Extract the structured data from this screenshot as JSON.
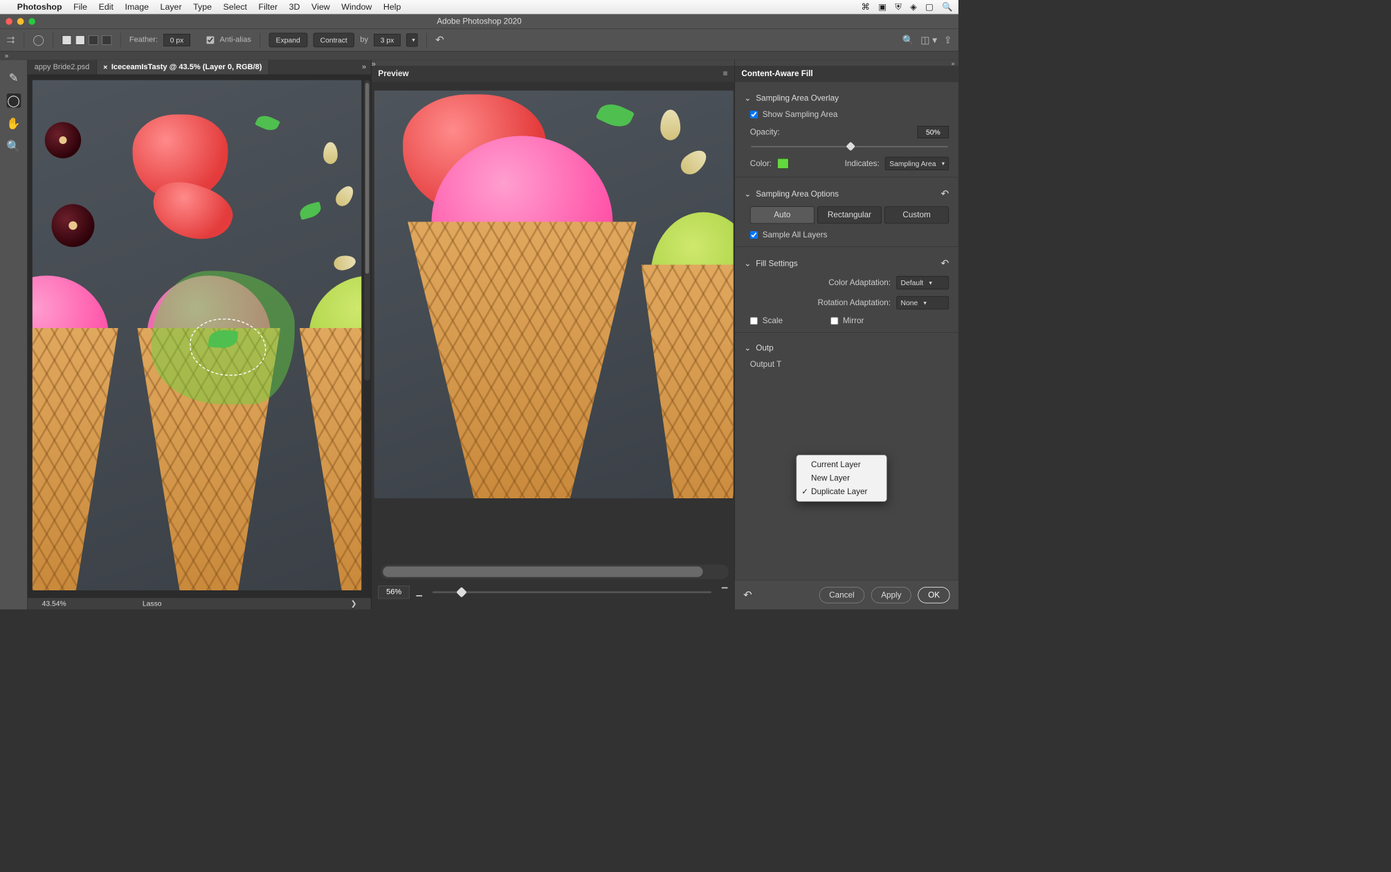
{
  "menubar": {
    "app": "Photoshop",
    "items": [
      "File",
      "Edit",
      "Image",
      "Layer",
      "Type",
      "Select",
      "Filter",
      "3D",
      "View",
      "Window",
      "Help"
    ],
    "tray_icons": [
      "creative-cloud",
      "bridge",
      "shield",
      "cube",
      "fullscreen",
      "search"
    ]
  },
  "window": {
    "title": "Adobe Photoshop 2020"
  },
  "optionsbar": {
    "feather_label": "Feather:",
    "feather_value": "0 px",
    "anti_alias_label": "Anti-alias",
    "anti_alias_checked": true,
    "expand_label": "Expand",
    "contract_label": "Contract",
    "by_label": "by",
    "by_value": "3 px"
  },
  "tabs": [
    {
      "label": "appy Bride2.psd",
      "active": false
    },
    {
      "label": "IceceamIsTasty @ 43.5% (Layer 0, RGB/8)",
      "active": true
    }
  ],
  "tools": [
    {
      "name": "brush-tool"
    },
    {
      "name": "lasso-tool",
      "active": true
    },
    {
      "name": "hand-tool"
    },
    {
      "name": "zoom-tool"
    }
  ],
  "status": {
    "zoom": "43.54%",
    "tool": "Lasso"
  },
  "preview": {
    "title": "Preview",
    "zoom": "56%"
  },
  "panel": {
    "title": "Content-Aware Fill",
    "sampling_overlay": {
      "title": "Sampling Area Overlay",
      "show_label": "Show Sampling Area",
      "show_checked": true,
      "opacity_label": "Opacity:",
      "opacity_value": "50%",
      "color_label": "Color:",
      "color_hex": "#63d83f",
      "indicates_label": "Indicates:",
      "indicates_value": "Sampling Area"
    },
    "sampling_options": {
      "title": "Sampling Area Options",
      "segments": [
        "Auto",
        "Rectangular",
        "Custom"
      ],
      "active_index": 0,
      "sample_all_label": "Sample All Layers",
      "sample_all_checked": true
    },
    "fill": {
      "title": "Fill Settings",
      "color_adapt_label": "Color Adaptation:",
      "color_adapt_value": "Default",
      "rotation_label": "Rotation Adaptation:",
      "rotation_value": "None",
      "scale_label": "Scale",
      "mirror_label": "Mirror"
    },
    "output": {
      "title": "Outp",
      "output_to_label": "Output T",
      "menu": {
        "items": [
          "Current Layer",
          "New Layer",
          "Duplicate Layer"
        ],
        "checked_index": 2
      }
    },
    "footer": {
      "cancel": "Cancel",
      "apply": "Apply",
      "ok": "OK"
    }
  }
}
